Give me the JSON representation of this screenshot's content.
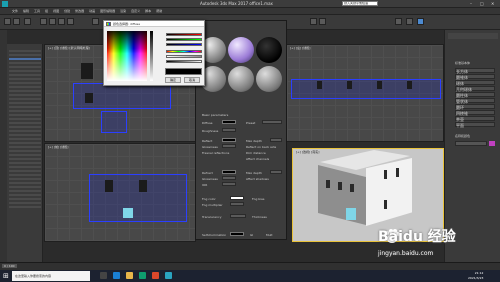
{
  "window": {
    "title": "Autodesk 3ds Max 2017    office1.max",
    "search_placeholder": "键入关键字或短语"
  },
  "menu": {
    "items": [
      "文件",
      "编辑",
      "工具",
      "组",
      "视图",
      "创建",
      "修改器",
      "动画",
      "图形编辑器",
      "渲染",
      "自定义",
      "脚本",
      "帮助"
    ]
  },
  "viewports": {
    "top": "[+] [顶] [线框] [默认明暗处理]",
    "front": "[+] [前] [线框]",
    "left": "[+] [左] [线框]",
    "persp": "[+] [透视] [真实]"
  },
  "color_picker": {
    "title": "颜色选择器: diffuse",
    "ok": "确定",
    "cancel": "取消",
    "reset": "重置"
  },
  "material_editor": {
    "rows": [
      "Basic parameters",
      "Diffuse",
      "Roughness",
      "Reflect",
      "Glossiness",
      "Fresnel reflections",
      "Refract",
      "Glossiness",
      "IOR",
      "Fog color",
      "Fog multiplier",
      "Translucency",
      "Self-illumination"
    ],
    "right_labels": [
      "Preset",
      "Max depth",
      "Reflect on back side",
      "Dim distance",
      "Affect channels",
      "Max depth",
      "Affect shadows",
      "Fog bias",
      "Thickness",
      "GI",
      "Mult"
    ]
  },
  "command_panel": {
    "title": "标准基本体",
    "buttons": [
      "长方体",
      "圆锥体",
      "球体",
      "几何球体",
      "圆柱体",
      "管状体",
      "圆环",
      "四棱锥",
      "茶壶",
      "平面"
    ],
    "section": "名称和颜色"
  },
  "timeline": {
    "frame": "0 / 100"
  },
  "taskbar": {
    "search": "在这里输入你要搜索的内容",
    "time": "21:12",
    "date": "2021/3/23"
  },
  "watermark": {
    "brand": "Baidu 经验",
    "url": "jingyan.baidu.com"
  },
  "colors": {
    "selection_blue": "#2b3fff",
    "active_viewport": "#e8c23a"
  }
}
